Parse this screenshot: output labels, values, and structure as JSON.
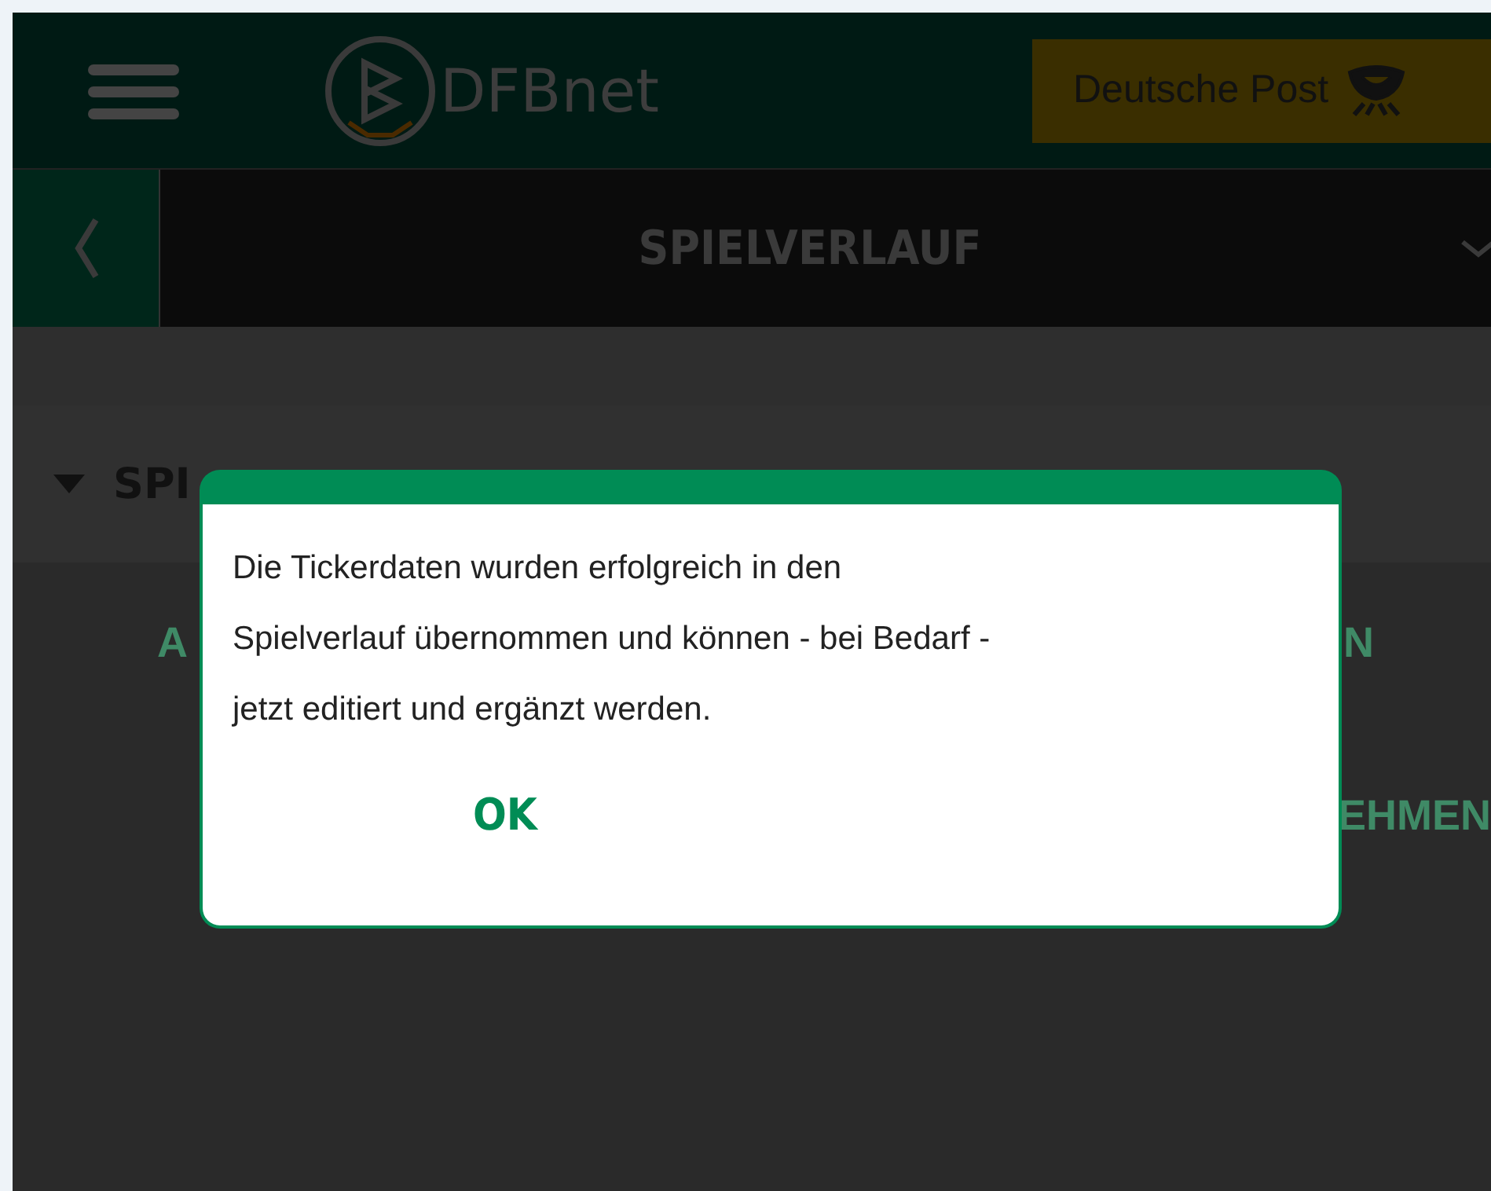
{
  "header": {
    "logo_text": "DFBnet",
    "sponsor": "Deutsche Post"
  },
  "title_bar": {
    "title": "SPIELVERLAUF"
  },
  "section": {
    "title": "SPI",
    "expanded": true
  },
  "background_texts": [
    {
      "kind": "left",
      "text": "A"
    },
    {
      "kind": "right",
      "text": "N"
    },
    {
      "kind": "edge",
      "text": "EHMEN"
    }
  ],
  "dialog": {
    "message": "Die Tickerdaten wurden erfolgreich in den\nSpielverlauf übernommen und können - bei Bedarf -\njetzt editiert und ergänzt werden.",
    "button": "OK"
  }
}
